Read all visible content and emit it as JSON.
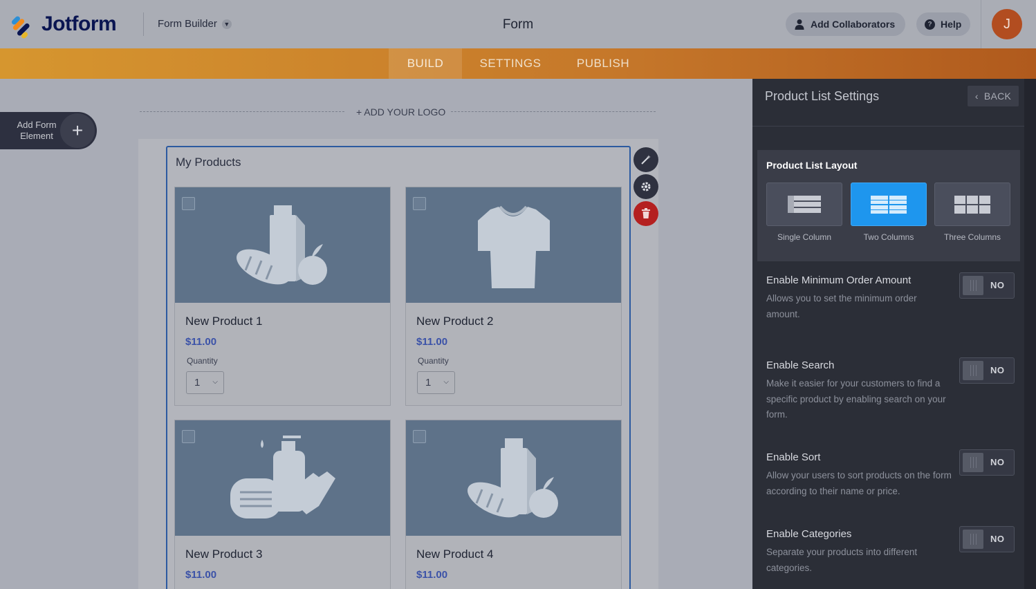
{
  "app": {
    "brand": "Jotform",
    "mode": "Form Builder",
    "form_title": "Form",
    "add_collaborators": "Add Collaborators",
    "help": "Help",
    "avatar_initial": "J"
  },
  "nav": {
    "tabs": [
      {
        "label": "BUILD",
        "active": true
      },
      {
        "label": "SETTINGS",
        "active": false
      },
      {
        "label": "PUBLISH",
        "active": false
      }
    ]
  },
  "canvas": {
    "add_element_label": "Add Form Element",
    "add_logo": "+ ADD YOUR LOGO",
    "field_label": "My Products",
    "quantity_label": "Quantity",
    "products": [
      {
        "name": "New Product 1",
        "price": "$11.00",
        "quantity": "1",
        "image": "grocery-icon"
      },
      {
        "name": "New Product 2",
        "price": "$11.00",
        "quantity": "1",
        "image": "tshirt-icon"
      },
      {
        "name": "New Product 3",
        "price": "$11.00",
        "image": "hygiene-icon"
      },
      {
        "name": "New Product 4",
        "price": "$11.00",
        "image": "grocery-icon"
      }
    ]
  },
  "panel": {
    "title": "Product List Settings",
    "back": "BACK",
    "layout": {
      "title": "Product List Layout",
      "options": [
        {
          "label": "Single Column",
          "selected": false
        },
        {
          "label": "Two Columns",
          "selected": true
        },
        {
          "label": "Three Columns",
          "selected": false
        }
      ]
    },
    "settings": [
      {
        "title": "Enable Minimum Order Amount",
        "desc": "Allows you to set the minimum order amount.",
        "value": "NO"
      },
      {
        "title": "Enable Search",
        "desc": "Make it easier for your customers to find a specific product by enabling search on your form.",
        "value": "NO"
      },
      {
        "title": "Enable Sort",
        "desc": "Allow your users to sort products on the form according to their name or price.",
        "value": "NO"
      },
      {
        "title": "Enable Categories",
        "desc": "Separate your products into different categories.",
        "value": "NO"
      }
    ]
  },
  "colors": {
    "accent_blue": "#1e96ee",
    "nav_orange": "#c5772a",
    "delete_red": "#b42020",
    "price_blue": "#3b52a8"
  }
}
